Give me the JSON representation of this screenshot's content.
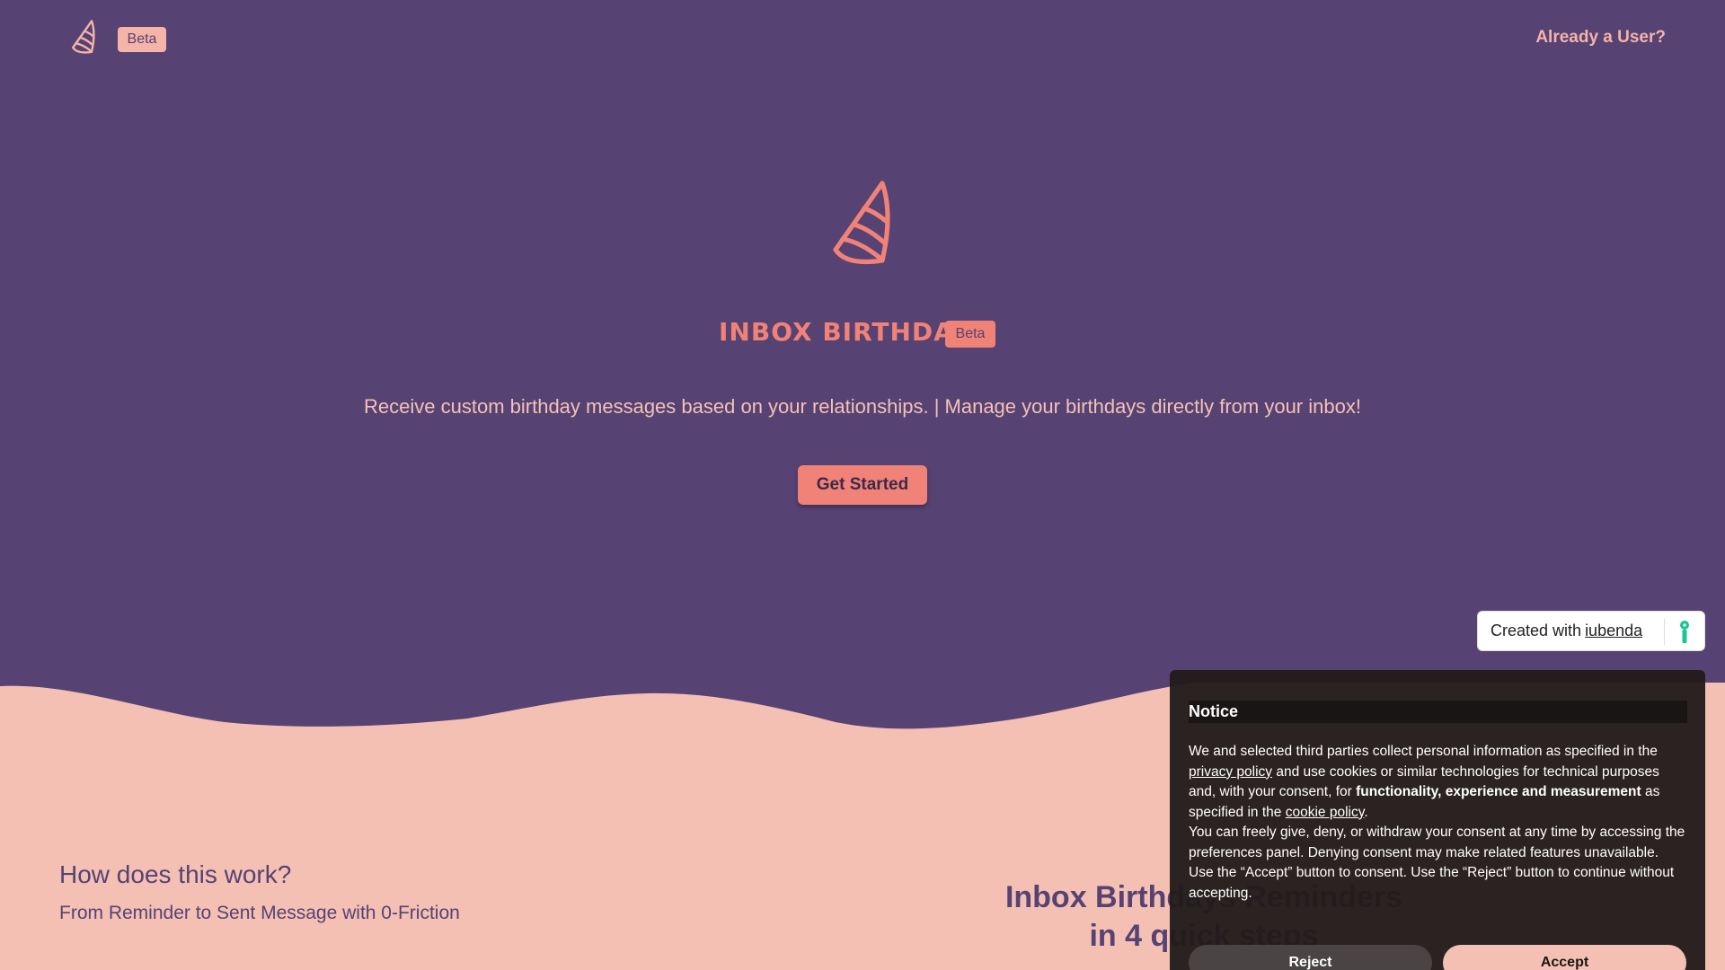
{
  "header": {
    "logo_icon": "party-hat-icon",
    "beta": "Beta",
    "already_user": "Already a User?"
  },
  "hero": {
    "logo_icon": "party-hat-icon",
    "brand": "INBOX BIRTHDAYS",
    "beta": "Beta",
    "tagline": "Receive custom birthday messages based on your relationships. | Manage your birthdays directly from your inbox!",
    "cta": "Get Started"
  },
  "how": {
    "title": "How does this work?",
    "subtitle": "From Reminder to Sent Message with 0-Friction",
    "steps_line1": "Inbox Birthdays Reminders",
    "steps_line2": "in 4 quick steps"
  },
  "iubenda": {
    "prefix": "Created with",
    "link": "iubenda",
    "icon": "iubenda-keyhole-icon"
  },
  "notice": {
    "title": "Notice",
    "p1_a": "We and selected third parties collect personal information as specified in the ",
    "p1_link1": "privacy policy",
    "p1_b": " and use cookies or similar technologies for technical purposes and, with your consent, for ",
    "p1_bold": "functionality, experience and measurement",
    "p1_c": " as specified in the ",
    "p1_link2": "cookie policy",
    "p1_d": ".",
    "p2": "You can freely give, deny, or withdraw your consent at any time by accessing the preferences panel. Denying consent may make related features unavailable.",
    "p3": "Use the “Accept” button to consent. Use the “Reject” button to continue without accepting.",
    "reject": "Reject",
    "accept": "Accept"
  },
  "colors": {
    "background": "#564273",
    "accent": "#f08277",
    "light": "#f4b4a7"
  }
}
